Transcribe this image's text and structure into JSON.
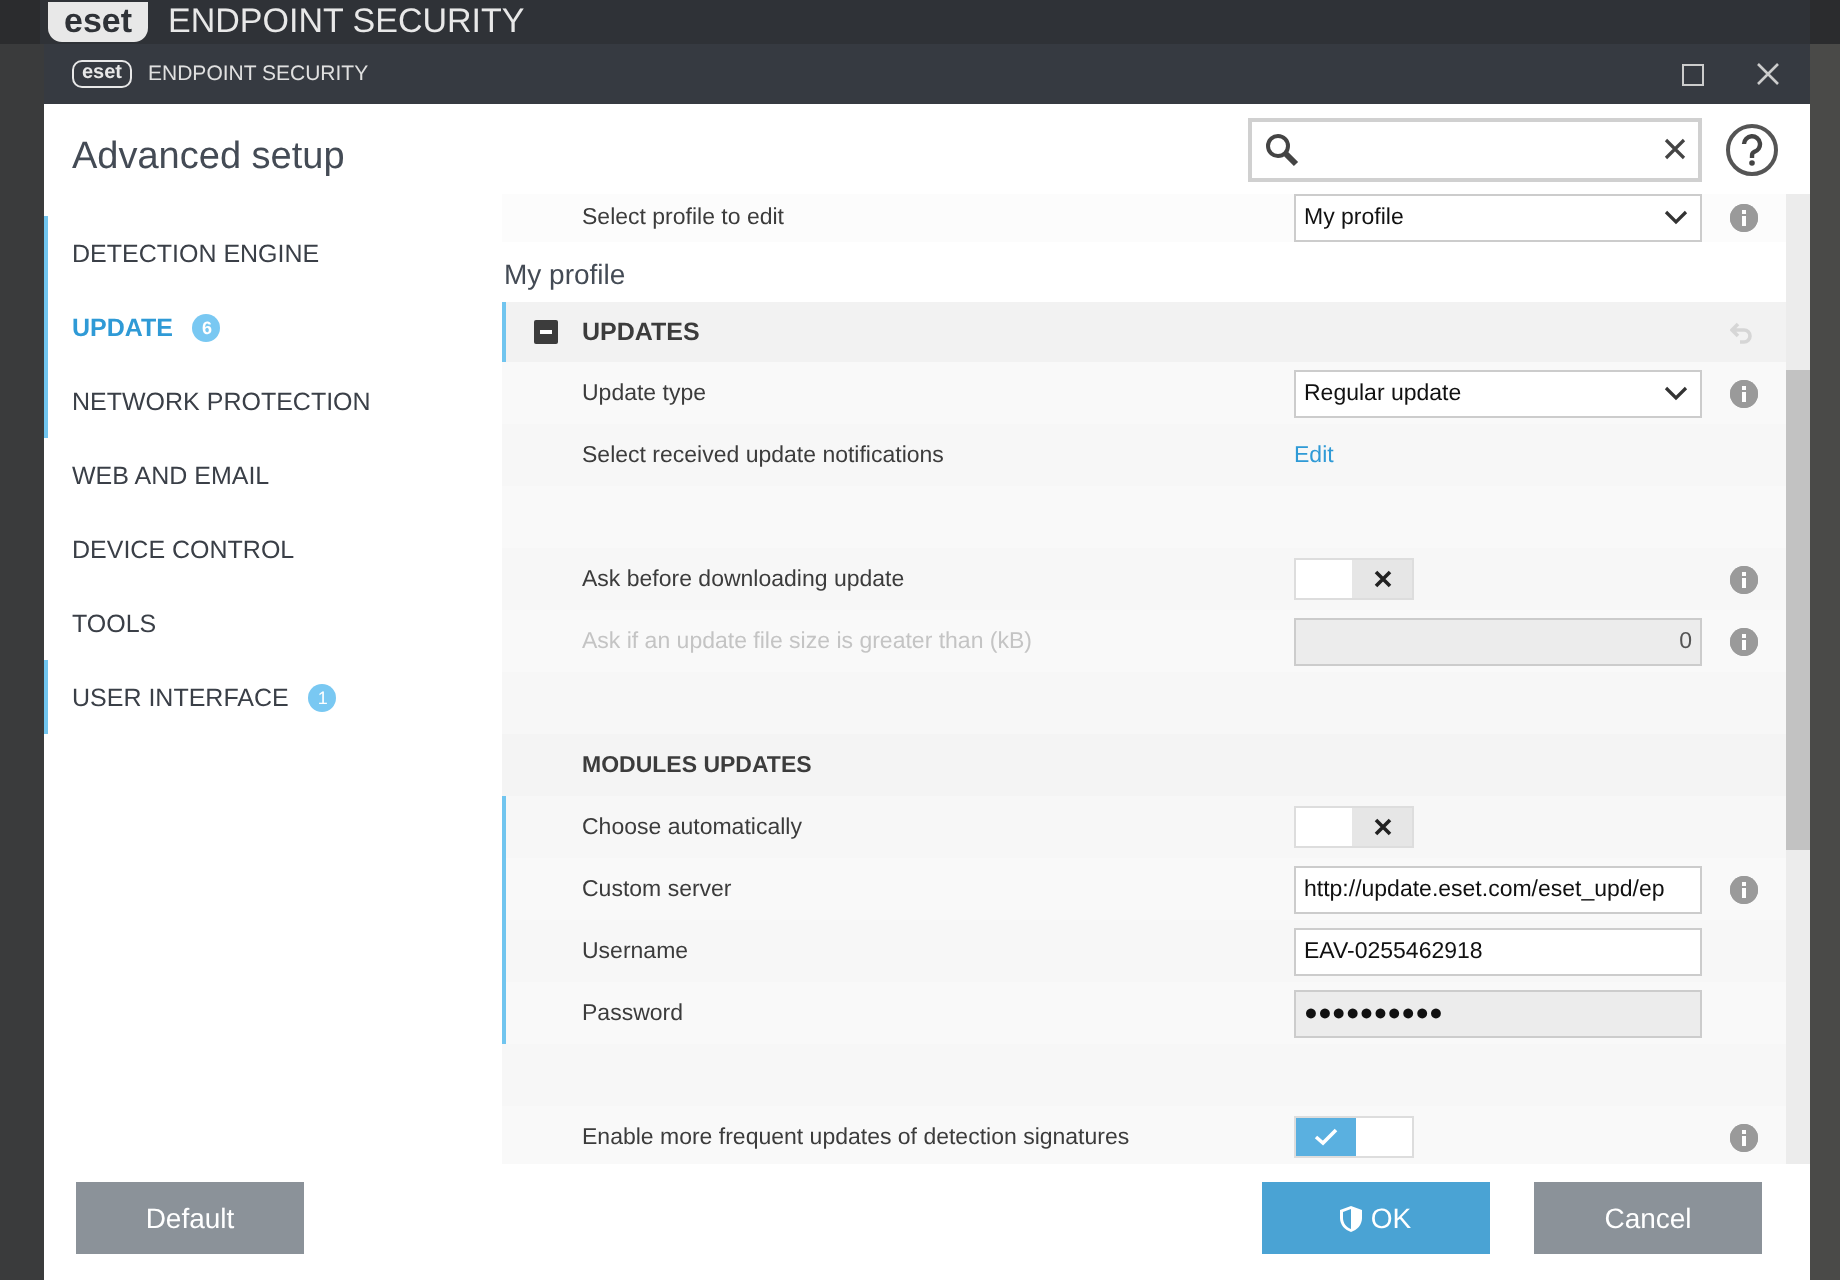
{
  "app_bar": {
    "logo": "eset",
    "title": "ENDPOINT SECURITY"
  },
  "window": {
    "logo": "eset",
    "title": "ENDPOINT SECURITY"
  },
  "heading": "Advanced setup",
  "sidebar": {
    "items": [
      {
        "label": "DETECTION ENGINE",
        "selected": false,
        "marked": true
      },
      {
        "label": "UPDATE",
        "selected": true,
        "marked": true,
        "badge": "6"
      },
      {
        "label": "NETWORK PROTECTION",
        "selected": false,
        "marked": true
      },
      {
        "label": "WEB AND EMAIL",
        "selected": false,
        "marked": false
      },
      {
        "label": "DEVICE CONTROL",
        "selected": false,
        "marked": false
      },
      {
        "label": "TOOLS",
        "selected": false,
        "marked": false
      },
      {
        "label": "USER INTERFACE",
        "selected": false,
        "marked": true,
        "badge": "1"
      }
    ]
  },
  "top_row": {
    "label": "Select profile to edit",
    "value": "My profile"
  },
  "profile_title": "My profile",
  "section": {
    "title": "UPDATES",
    "expanded": true,
    "marked": true
  },
  "rows": [
    {
      "kind": "select",
      "label": "Update type",
      "value": "Regular update",
      "info": true,
      "marked": false
    },
    {
      "kind": "link",
      "label": "Select received update notifications",
      "value": "Edit",
      "info": false,
      "marked": false
    },
    {
      "kind": "spacer"
    },
    {
      "kind": "toggle",
      "label": "Ask before downloading update",
      "on": false,
      "info": true,
      "marked": false
    },
    {
      "kind": "number",
      "label": "Ask if an update file size is greater than (kB)",
      "value": "0",
      "disabled": true,
      "info": true,
      "marked": false
    },
    {
      "kind": "spacer"
    },
    {
      "kind": "heading",
      "label": "MODULES UPDATES"
    },
    {
      "kind": "toggle",
      "label": "Choose automatically",
      "on": false,
      "info": false,
      "marked": true
    },
    {
      "kind": "text",
      "label": "Custom server",
      "value": "http://update.eset.com/eset_upd/ep",
      "info": true,
      "marked": true
    },
    {
      "kind": "text",
      "label": "Username",
      "value": "EAV-0255462918",
      "info": false,
      "marked": true
    },
    {
      "kind": "password",
      "label": "Password",
      "value": "●●●●●●●●●●",
      "info": false,
      "marked": true
    },
    {
      "kind": "spacer"
    },
    {
      "kind": "toggle",
      "label": "Enable more frequent updates of detection signatures",
      "on": true,
      "info": true,
      "marked": false
    }
  ],
  "buttons": [
    {
      "label": "Default",
      "kind": "secondary"
    },
    {
      "label": "OK",
      "kind": "primary"
    },
    {
      "label": "Cancel",
      "kind": "secondary"
    }
  ]
}
